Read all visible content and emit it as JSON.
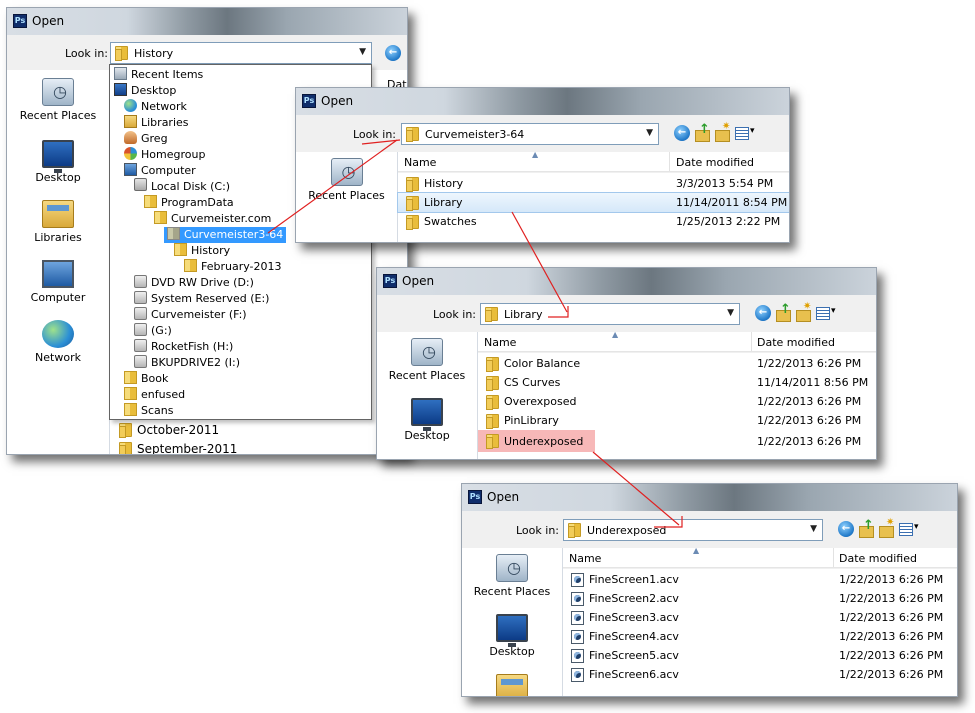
{
  "dialog1": {
    "title": "Open",
    "look_in_label": "Look in:",
    "look_in_value": "History",
    "partial_column": "Dat",
    "places": [
      "Recent Places",
      "Desktop",
      "Libraries",
      "Computer",
      "Network"
    ],
    "dropdown_items": [
      "Recent Items",
      "Desktop",
      "Network",
      "Libraries",
      "Greg",
      "Homegroup",
      "Computer",
      "Local Disk (C:)",
      "ProgramData",
      "Curvemeister.com",
      "Curvemeister3-64",
      "History",
      "February-2013",
      "DVD RW Drive (D:)",
      "System Reserved (E:)",
      "Curvemeister (F:)",
      "(G:)",
      "RocketFish (H:)",
      "BKUPDRIVE2 (I:)",
      "Book",
      "enfused",
      "Scans"
    ],
    "below_dropdown": [
      "October-2011",
      "September-2011"
    ]
  },
  "dialog2": {
    "title": "Open",
    "look_in_label": "Look in:",
    "look_in_value": "Curvemeister3-64",
    "places": [
      "Recent Places"
    ],
    "col_name": "Name",
    "col_date": "Date modified",
    "rows": [
      {
        "name": "History",
        "date": "3/3/2013 5:54 PM"
      },
      {
        "name": "Library",
        "date": "11/14/2011 8:54 PM"
      },
      {
        "name": "Swatches",
        "date": "1/25/2013 2:22 PM"
      }
    ]
  },
  "dialog3": {
    "title": "Open",
    "look_in_label": "Look in:",
    "look_in_value": "Library",
    "places": [
      "Recent Places",
      "Desktop"
    ],
    "col_name": "Name",
    "col_date": "Date modified",
    "rows": [
      {
        "name": "Color Balance",
        "date": "1/22/2013 6:26 PM"
      },
      {
        "name": "CS Curves",
        "date": "11/14/2011 8:56 PM"
      },
      {
        "name": "Overexposed",
        "date": "1/22/2013 6:26 PM"
      },
      {
        "name": "PinLibrary",
        "date": "1/22/2013 6:26 PM"
      },
      {
        "name": "Underexposed",
        "date": "1/22/2013 6:26 PM"
      }
    ]
  },
  "dialog4": {
    "title": "Open",
    "look_in_label": "Look in:",
    "look_in_value": "Underexposed",
    "places": [
      "Recent Places",
      "Desktop"
    ],
    "col_name": "Name",
    "col_date": "Date modified",
    "rows": [
      {
        "name": "FineScreen1.acv",
        "date": "1/22/2013 6:26 PM"
      },
      {
        "name": "FineScreen2.acv",
        "date": "1/22/2013 6:26 PM"
      },
      {
        "name": "FineScreen3.acv",
        "date": "1/22/2013 6:26 PM"
      },
      {
        "name": "FineScreen4.acv",
        "date": "1/22/2013 6:26 PM"
      },
      {
        "name": "FineScreen5.acv",
        "date": "1/22/2013 6:26 PM"
      },
      {
        "name": "FineScreen6.acv",
        "date": "1/22/2013 6:26 PM"
      }
    ]
  },
  "icons": {
    "app": "Ps",
    "back": "back-arrow-icon",
    "up": "up-folder-icon",
    "new_folder": "new-folder-icon",
    "views": "views-menu-icon",
    "dropdown": "chevron-down-icon"
  },
  "colors": {
    "selection": "#3399ff",
    "highlight": "#f5a6a6",
    "annotation_arrow": "#e02020"
  }
}
